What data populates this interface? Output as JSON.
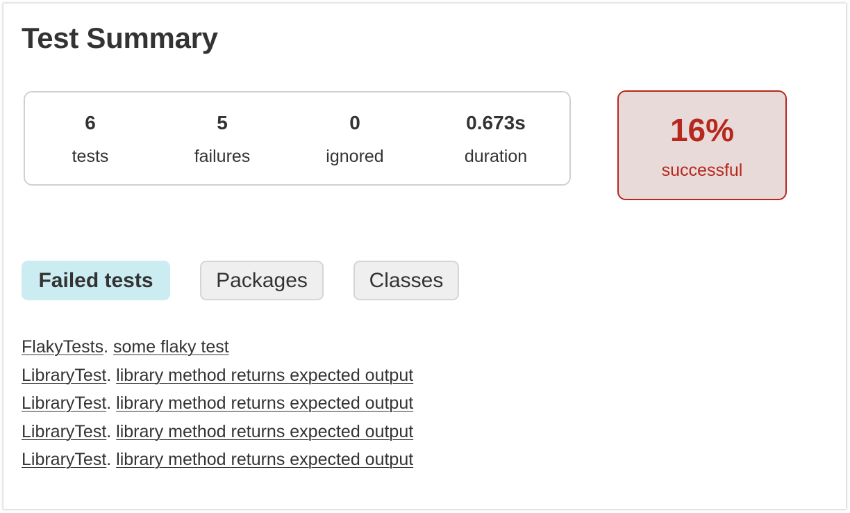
{
  "page_title": "Test Summary",
  "summary": {
    "counters": [
      {
        "value": "6",
        "label": "tests"
      },
      {
        "value": "5",
        "label": "failures"
      },
      {
        "value": "0",
        "label": "ignored"
      },
      {
        "value": "0.673s",
        "label": "duration"
      }
    ],
    "success_rate": {
      "value": "16%",
      "label": "successful",
      "status": "failures",
      "color": "#b6271d",
      "background": "#e9dada"
    }
  },
  "tabs": [
    {
      "label": "Failed tests",
      "selected": true
    },
    {
      "label": "Packages",
      "selected": false
    },
    {
      "label": "Classes",
      "selected": false
    }
  ],
  "failed_tests": [
    {
      "class_name": "FlakyTests",
      "separator": ".",
      "test_name": "some flaky test"
    },
    {
      "class_name": "LibraryTest",
      "separator": ".",
      "test_name": "library method returns expected output"
    },
    {
      "class_name": "LibraryTest",
      "separator": ".",
      "test_name": "library method returns expected output"
    },
    {
      "class_name": "LibraryTest",
      "separator": ".",
      "test_name": "library method returns expected output"
    },
    {
      "class_name": "LibraryTest",
      "separator": ".",
      "test_name": "library method returns expected output"
    }
  ],
  "colors": {
    "text": "#333333",
    "selected_tab_bg": "#cbedf2",
    "tab_bg": "#efefef",
    "border": "#d0d0d0"
  }
}
